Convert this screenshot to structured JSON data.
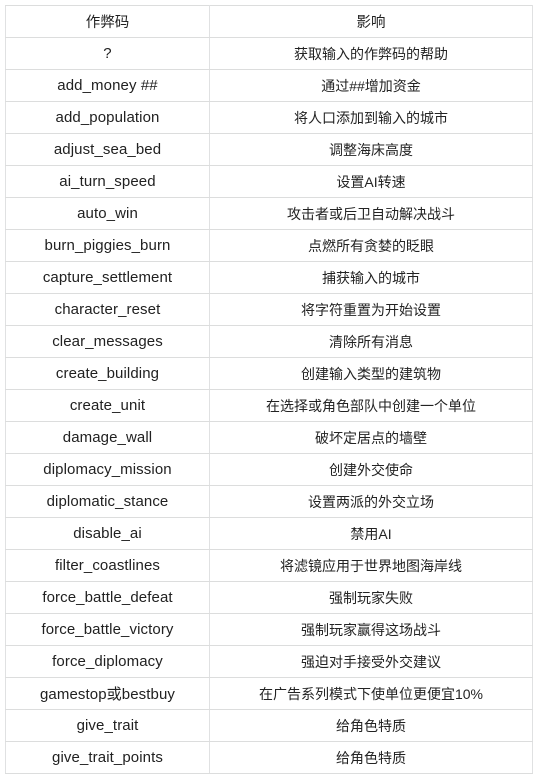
{
  "table": {
    "headers": {
      "code": "作弊码",
      "effect": "影响"
    },
    "rows": [
      {
        "code": "?",
        "effect": "获取输入的作弊码的帮助"
      },
      {
        "code": "add_money ##",
        "effect": "通过##增加资金"
      },
      {
        "code": "add_population",
        "effect": "将人口添加到输入的城市"
      },
      {
        "code": "adjust_sea_bed",
        "effect": "调整海床高度"
      },
      {
        "code": "ai_turn_speed",
        "effect": "设置AI转速"
      },
      {
        "code": "auto_win",
        "effect": "攻击者或后卫自动解决战斗"
      },
      {
        "code": "burn_piggies_burn",
        "effect": "点燃所有贪婪的眨眼"
      },
      {
        "code": "capture_settlement",
        "effect": "捕获输入的城市"
      },
      {
        "code": "character_reset",
        "effect": "将字符重置为开始设置"
      },
      {
        "code": "clear_messages",
        "effect": "清除所有消息"
      },
      {
        "code": "create_building",
        "effect": "创建输入类型的建筑物"
      },
      {
        "code": "create_unit",
        "effect": "在选择或角色部队中创建一个单位"
      },
      {
        "code": "damage_wall",
        "effect": "破坏定居点的墙壁"
      },
      {
        "code": "diplomacy_mission",
        "effect": "创建外交使命"
      },
      {
        "code": "diplomatic_stance",
        "effect": "设置两派的外交立场"
      },
      {
        "code": "disable_ai",
        "effect": "禁用AI"
      },
      {
        "code": "filter_coastlines",
        "effect": "将滤镜应用于世界地图海岸线"
      },
      {
        "code": "force_battle_defeat",
        "effect": "强制玩家失败"
      },
      {
        "code": "force_battle_victory",
        "effect": "强制玩家赢得这场战斗"
      },
      {
        "code": "force_diplomacy",
        "effect": "强迫对手接受外交建议"
      },
      {
        "code": "gamestop或bestbuy",
        "effect": "在广告系列模式下使单位更便宜10%"
      },
      {
        "code": "give_trait",
        "effect": "给角色特质"
      },
      {
        "code": "give_trait_points",
        "effect": "给角色特质"
      }
    ]
  },
  "colors": {
    "border": "#e0e1e2",
    "text": "#232323",
    "background": "#ffffff"
  }
}
